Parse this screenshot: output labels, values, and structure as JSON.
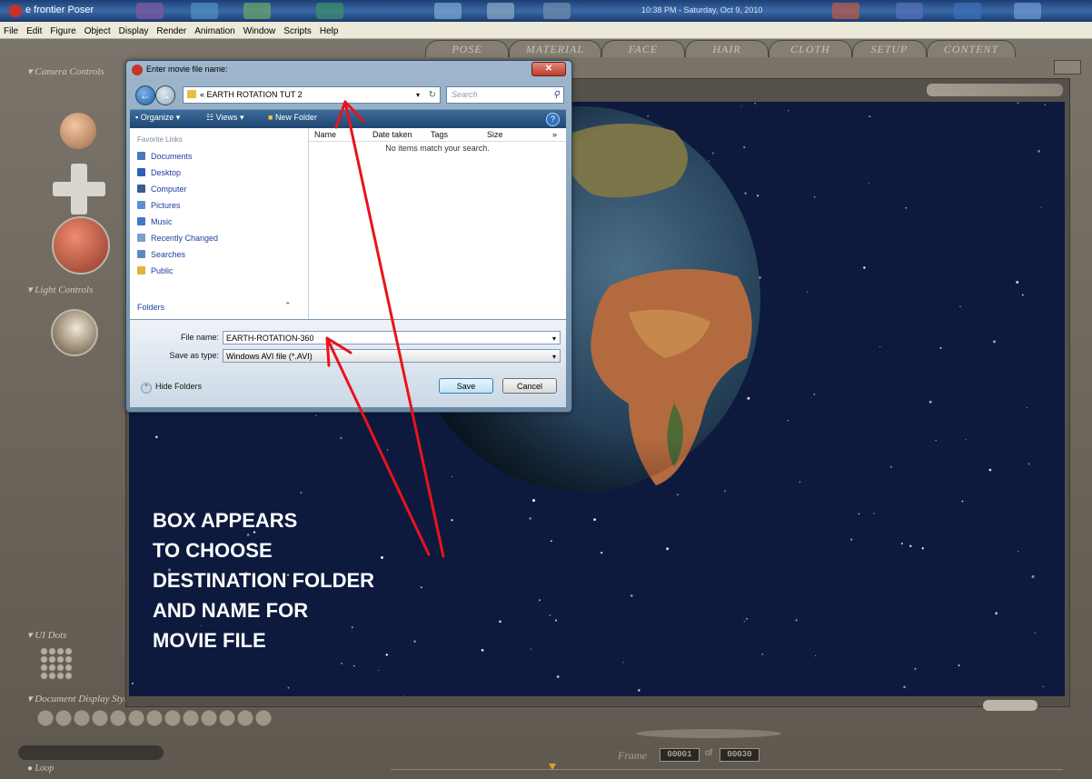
{
  "taskbar": {
    "app_title": "e frontier Poser",
    "clock": "10:38 PM - Saturday, Oct 9, 2010"
  },
  "menubar": {
    "items": [
      "File",
      "Edit",
      "Figure",
      "Object",
      "Display",
      "Render",
      "Animation",
      "Window",
      "Scripts",
      "Help"
    ]
  },
  "rooms": [
    "POSE",
    "MATERIAL",
    "FACE",
    "HAIR",
    "CLOTH",
    "SETUP",
    "CONTENT"
  ],
  "side_panel": {
    "camera_controls": "Camera Controls",
    "light_controls": "Light Controls",
    "ui_dots": "UI Dots",
    "document_display": "Document Display Style",
    "loop": "Loop"
  },
  "dialog": {
    "title": "Enter movie file name:",
    "address": "« EARTH ROTATION TUT 2",
    "search_placeholder": "Search",
    "toolbar": {
      "organize": "Organize",
      "views": "Views",
      "new_folder": "New Folder"
    },
    "favorite_links_header": "Favorite Links",
    "favorite_links": [
      "Documents",
      "Desktop",
      "Computer",
      "Pictures",
      "Music",
      "Recently Changed",
      "Searches",
      "Public"
    ],
    "favorite_link_colors": [
      "#4a78b6",
      "#2f5fb3",
      "#3b5d8f",
      "#5b8fd0",
      "#3b7bc8",
      "#7aa0c8",
      "#5a8cc2",
      "#e2b23a"
    ],
    "folders_label": "Folders",
    "columns": [
      "Name",
      "Date taken",
      "Tags",
      "Size"
    ],
    "empty_message": "No items match your search.",
    "file_name_label": "File name:",
    "file_name_value": "EARTH-ROTATION-360",
    "save_type_label": "Save as type:",
    "save_type_value": "Windows AVI file (*.AVI)",
    "hide_folders": "Hide Folders",
    "save_button": "Save",
    "cancel_button": "Cancel"
  },
  "instruction": "BOX APPEARS\nTO CHOOSE\nDESTINATION FOLDER\nAND NAME FOR\nMOVIE FILE",
  "frame": {
    "label": "Frame",
    "current": "00001",
    "total": "00030"
  },
  "colors": {
    "annotation_arrow": "#e8141a",
    "space": "#0d1a3e",
    "dialog_frame": "#9fb7cc"
  }
}
